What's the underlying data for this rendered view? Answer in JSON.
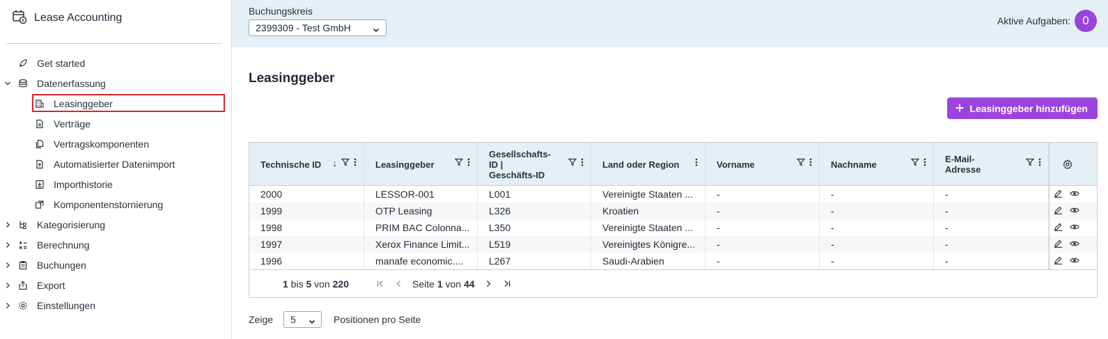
{
  "app": {
    "title": "Lease Accounting"
  },
  "sidebar": {
    "items": [
      {
        "label": "Get started",
        "icon": "rocket-icon",
        "level": 0,
        "chevron": ""
      },
      {
        "label": "Datenerfassung",
        "icon": "database-icon",
        "level": 0,
        "chevron": "down"
      },
      {
        "label": "Leasinggeber",
        "icon": "building-icon",
        "level": 1,
        "selected": true
      },
      {
        "label": "Verträge",
        "icon": "document-icon",
        "level": 1
      },
      {
        "label": "Vertragskomponenten",
        "icon": "documents-icon",
        "level": 1
      },
      {
        "label": "Automatisierter Datenimport",
        "icon": "file-upload-icon",
        "level": 1
      },
      {
        "label": "Importhistorie",
        "icon": "import-history-icon",
        "level": 1
      },
      {
        "label": "Komponentenstornierung",
        "icon": "reverse-icon",
        "level": 1
      },
      {
        "label": "Kategorisierung",
        "icon": "hierarchy-icon",
        "level": 0,
        "chevron": "right"
      },
      {
        "label": "Berechnung",
        "icon": "calculator-icon",
        "level": 0,
        "chevron": "right"
      },
      {
        "label": "Buchungen",
        "icon": "clipboard-icon",
        "level": 0,
        "chevron": "right"
      },
      {
        "label": "Export",
        "icon": "export-icon",
        "level": 0,
        "chevron": "right"
      },
      {
        "label": "Einstellungen",
        "icon": "gear-icon",
        "level": 0,
        "chevron": "right"
      }
    ]
  },
  "topbar": {
    "company_label": "Buchungskreis",
    "company_value": "2399309 - Test GmbH",
    "tasks_label": "Aktive Aufgaben:",
    "tasks_count": "0"
  },
  "page": {
    "title": "Leasinggeber",
    "add_button": "Leasinggeber hinzufügen"
  },
  "table": {
    "columns": [
      {
        "lines": [
          "Technische ID"
        ],
        "sort": "↓",
        "filter": true
      },
      {
        "lines": [
          "Leasinggeber"
        ],
        "filter": true
      },
      {
        "lines": [
          "Gesellschafts-",
          "ID |",
          "Geschäfts-ID"
        ],
        "filter": true
      },
      {
        "lines": [
          "Land oder Region"
        ],
        "filter": false
      },
      {
        "lines": [
          "Vorname"
        ],
        "filter": true
      },
      {
        "lines": [
          "Nachname"
        ],
        "filter": true
      },
      {
        "lines": [
          "E-Mail-",
          "Adresse"
        ],
        "filter": true
      }
    ],
    "rows": [
      [
        "2000",
        "LESSOR-001",
        "L001",
        "Vereinigte Staaten ...",
        "-",
        "-",
        "-"
      ],
      [
        "1999",
        "OTP Leasing",
        "L326",
        "Kroatien",
        "-",
        "-",
        "-"
      ],
      [
        "1998",
        "PRIM BAC Colonna...",
        "L350",
        "Vereinigte Staaten ...",
        "-",
        "-",
        "-"
      ],
      [
        "1997",
        "Xerox Finance Limit...",
        "L519",
        "Vereinigtes Königre...",
        "-",
        "-",
        "-"
      ],
      [
        "1996",
        "manafe economic....",
        "L267",
        "Saudi-Arabien",
        "-",
        "-",
        "-"
      ]
    ],
    "footer": {
      "range_from": "1",
      "range_to": "5",
      "range_total": "220",
      "txt_bis": "bis",
      "txt_von": "von",
      "page_label": "Seite",
      "page_current": "1",
      "page_total": "44"
    }
  },
  "perpage": {
    "prefix": "Zeige",
    "value": "5",
    "suffix": "Positionen pro Seite"
  },
  "colors": {
    "accent": "#9b44dd",
    "topbar_bg": "#e4f0f6",
    "highlight": "#d9262c"
  }
}
